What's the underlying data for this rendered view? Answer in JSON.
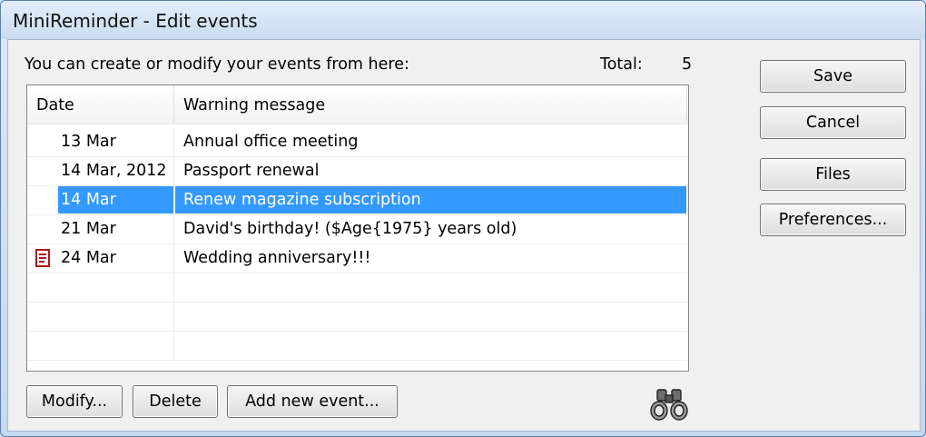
{
  "window": {
    "title": "MiniReminder - Edit events"
  },
  "header": {
    "intro": "You can create or modify your events from here:",
    "total_label": "Total:",
    "total_value": "5"
  },
  "list": {
    "columns": [
      "Date",
      "Warning message"
    ],
    "rows": [
      {
        "date": "13 Mar",
        "message": "Annual office meeting",
        "selected": false,
        "icon": ""
      },
      {
        "date": "14 Mar, 2012",
        "message": "Passport renewal",
        "selected": false,
        "icon": ""
      },
      {
        "date": "14 Mar",
        "message": "Renew magazine subscription",
        "selected": true,
        "icon": ""
      },
      {
        "date": "21 Mar",
        "message": "David's birthday! ($Age{1975} years old)",
        "selected": false,
        "icon": ""
      },
      {
        "date": "24 Mar",
        "message": "Wedding anniversary!!!",
        "selected": false,
        "icon": "note-icon"
      }
    ]
  },
  "buttons": {
    "save": "Save",
    "cancel": "Cancel",
    "files": "Files",
    "preferences": "Preferences...",
    "modify": "Modify...",
    "delete": "Delete",
    "add": "Add new event..."
  },
  "icons": {
    "search": "binoculars-icon"
  },
  "colors": {
    "selection": "#3399ff",
    "note_icon": "#b01818"
  }
}
